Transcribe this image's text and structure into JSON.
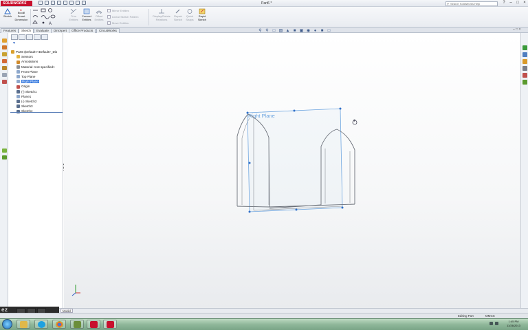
{
  "app": {
    "logo_text": "SOLIDWORKS",
    "document_title": "Part6 *",
    "search_placeholder": "Search SolidWorks Help"
  },
  "ribbon": {
    "sketch_label": "Sketch",
    "smart_dimension_label": "Smart Dimension",
    "trim_entities_label": "Trim Entities",
    "convert_entities_label": "Convert Entities",
    "offset_entities_label": "Offset Entities",
    "mirror_entities_label": "Mirror Entities",
    "linear_pattern_label": "Linear Sketch Pattern",
    "move_entities_label": "Move Entities",
    "display_relations_label": "Display/Delete Relations",
    "repair_sketch_label": "Repair Sketch",
    "quick_snaps_label": "Quick Snaps",
    "rapid_sketch_label": "Rapid Sketch"
  },
  "tabs": [
    "Features",
    "Sketch",
    "Evaluate",
    "DimXpert",
    "Office Products",
    "CircuitWorks"
  ],
  "active_tab": "Sketch",
  "feature_tree": [
    {
      "label": "Part6  (Default<<Default>_Dis",
      "level": 0,
      "icon_color": "#d9a02c",
      "selected": false
    },
    {
      "label": "Sensors",
      "level": 1,
      "icon_color": "#e6b43c",
      "selected": false
    },
    {
      "label": "Annotations",
      "level": 1,
      "icon_color": "#d08a2a",
      "selected": false
    },
    {
      "label": "Material <not specified>",
      "level": 1,
      "icon_color": "#8a8f96",
      "selected": false
    },
    {
      "label": "Front Plane",
      "level": 1,
      "icon_color": "#8ea8cc",
      "selected": false
    },
    {
      "label": "Top Plane",
      "level": 1,
      "icon_color": "#8ea8cc",
      "selected": false
    },
    {
      "label": "Right Plane",
      "level": 1,
      "icon_color": "#8ea8cc",
      "selected": true
    },
    {
      "label": "Origin",
      "level": 1,
      "icon_color": "#c0504d",
      "selected": false
    },
    {
      "label": "(-) Sketch1",
      "level": 1,
      "icon_color": "#5a6f8e",
      "selected": false
    },
    {
      "label": "Plane1",
      "level": 1,
      "icon_color": "#8ea8cc",
      "selected": false
    },
    {
      "label": "(-) Sketch2",
      "level": 1,
      "icon_color": "#5a6f8e",
      "selected": false
    },
    {
      "label": "Sketch3",
      "level": 1,
      "icon_color": "#5a6f8e",
      "selected": false
    },
    {
      "label": "Sketch4",
      "level": 1,
      "icon_color": "#5a6f8e",
      "selected": false
    }
  ],
  "graphics": {
    "plane_label": "Right Plane"
  },
  "ez_toolbar": {
    "brand": "ez",
    "buttons": [
      "PAUSE",
      "STOP",
      "DRAW"
    ]
  },
  "model_tab": "Model",
  "status": {
    "editing": "Editing Part",
    "units": "MMGS"
  },
  "taskbar": {
    "time": "1:45 PM",
    "date": "11/26/2013"
  },
  "colors": {
    "sketch_line": "#6a6f78",
    "plane": "#4a8fd6",
    "selection": "#3b7de0",
    "brand": "#c8102e"
  }
}
